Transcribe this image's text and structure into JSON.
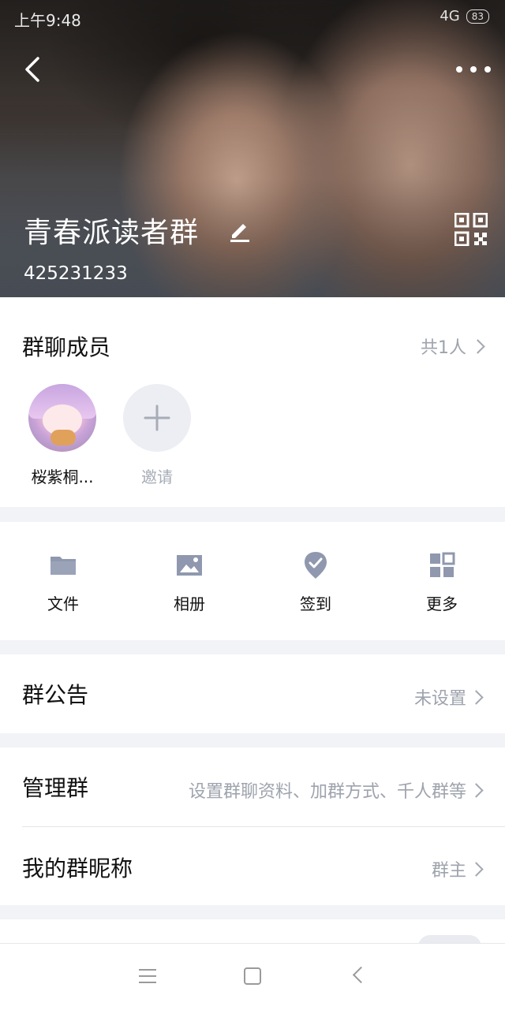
{
  "status_bar": {
    "time": "上午9:48",
    "network": "4G",
    "battery": "83"
  },
  "header": {
    "group_name": "青春派读者群",
    "group_id": "425231233",
    "back_icon": "chevron-left-icon",
    "more_icon": "more-dots-icon",
    "edit_icon": "pencil-icon",
    "qr_icon": "qr-code-icon"
  },
  "members": {
    "title": "群聊成员",
    "count": "共1人",
    "list": [
      {
        "name": "桜紫桐..."
      }
    ],
    "invite_label": "邀请"
  },
  "shortcuts": [
    {
      "label": "文件",
      "icon": "folder-icon"
    },
    {
      "label": "相册",
      "icon": "image-icon"
    },
    {
      "label": "签到",
      "icon": "check-badge-icon"
    },
    {
      "label": "更多",
      "icon": "grid-icon"
    }
  ],
  "notice": {
    "title": "群公告",
    "value": "未设置"
  },
  "manage": {
    "title": "管理群",
    "value": "设置群聊资料、加群方式、千人群等"
  },
  "nickname": {
    "title": "我的群昵称",
    "value": "群主"
  },
  "colors": {
    "accent_icon": "#8f98ae",
    "secondary_text": "#9ea3ad",
    "background": "#f2f3f7"
  }
}
